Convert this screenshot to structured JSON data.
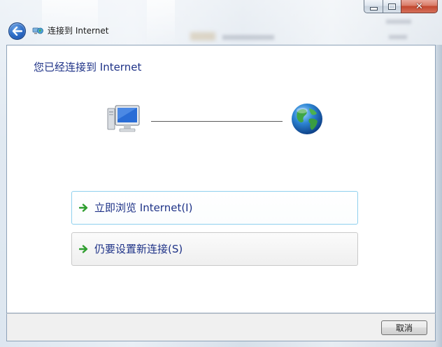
{
  "window": {
    "title": "连接到 Internet",
    "caption": {
      "minimize_icon": "minimize-icon",
      "maximize_icon": "maximize-icon",
      "close_glyph": "✕"
    },
    "back_icon": "back-arrow-icon",
    "title_icon": "network-connection-icon"
  },
  "content": {
    "heading": "您已经连接到 Internet",
    "computer_icon": "computer-icon",
    "globe_icon": "globe-icon",
    "commands": [
      {
        "label": "立即浏览 Internet(I)",
        "icon": "green-arrow-icon",
        "highlighted": true
      },
      {
        "label": "仍要设置新连接(S)",
        "icon": "green-arrow-icon",
        "highlighted": false
      }
    ]
  },
  "footer": {
    "cancel_label": "取消"
  },
  "colors": {
    "link_text": "#1e3287",
    "arrow_green": "#2f9e2f",
    "highlight_border": "#8fd0ee",
    "close_button": "#c2462d"
  }
}
